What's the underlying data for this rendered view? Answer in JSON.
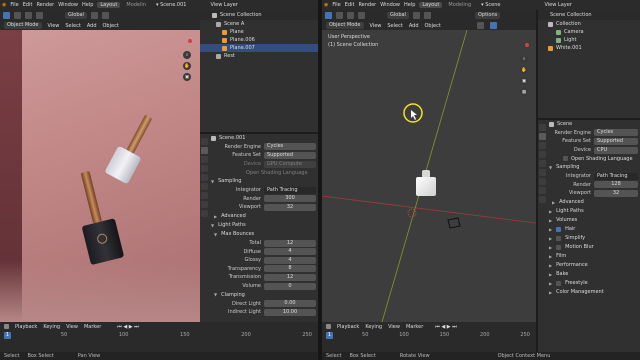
{
  "left": {
    "menu": {
      "file": "File",
      "edit": "Edit",
      "render": "Render",
      "window": "Window",
      "help": "Help",
      "layout": "Layout",
      "modeling": "Modelin",
      "scene": "Scene.001",
      "view_layer": "View Layer"
    },
    "vp_header": {
      "mode": "Object Mode",
      "view": "View",
      "select": "Select",
      "add": "Add",
      "object": "Object",
      "orientation": "Global",
      "options": "Options"
    },
    "outliner": {
      "title": "Scene Collection",
      "items": [
        {
          "name": "Scene A"
        },
        {
          "name": "Plane"
        },
        {
          "name": "Plane.006"
        },
        {
          "name": "Plane.007"
        },
        {
          "name": "Rest"
        }
      ]
    },
    "props": {
      "scene_name": "Scene.001",
      "render_engine_label": "Render Engine",
      "render_engine": "Cycles",
      "feature_set_label": "Feature Set",
      "feature_set": "Supported",
      "device_label": "Device",
      "device": "GPU Compute",
      "osl_label": "Open Shading Language",
      "sampling": "Sampling",
      "integrator_label": "Integrator",
      "integrator": "Path Tracing",
      "render_label": "Render",
      "render": "300",
      "viewport_label": "Viewport",
      "viewport": "32",
      "advanced": "Advanced",
      "light_paths": "Light Paths",
      "max_bounces": "Max Bounces",
      "total_label": "Total",
      "total": "12",
      "diffuse_label": "Diffuse",
      "diffuse": "4",
      "glossy_label": "Glossy",
      "glossy": "4",
      "transparency_label": "Transparency",
      "transparency": "8",
      "transmission_label": "Transmission",
      "transmission": "12",
      "volume_label": "Volume",
      "volume": "0",
      "clamping": "Clamping",
      "direct_label": "Direct Light",
      "direct": "0.00",
      "indirect_label": "Indirect Light",
      "indirect": "10.00"
    },
    "timeline": {
      "playback": "Playback",
      "keying": "Keying",
      "view": "View",
      "marker": "Marker",
      "frame": "1",
      "ticks": [
        "0",
        "50",
        "100",
        "150",
        "200",
        "250"
      ]
    },
    "status": {
      "select": "Select",
      "box": "Box Select",
      "pan": "Pan View"
    }
  },
  "right": {
    "menu": {
      "file": "File",
      "edit": "Edit",
      "render": "Render",
      "window": "Window",
      "help": "Help",
      "layout": "Layout",
      "modeling": "Modeling",
      "scene": "Scene",
      "view_layer": "View Layer"
    },
    "vp_header": {
      "mode": "Object Mode",
      "view": "View",
      "select": "Select",
      "add": "Add",
      "object": "Object",
      "orientation": "Global",
      "options": "Options"
    },
    "viewport": {
      "perspective": "User Perspective",
      "collection": "(1) Scene Collection"
    },
    "outliner": {
      "title": "Scene Collection",
      "items": [
        {
          "name": "Collection"
        },
        {
          "name": "Camera"
        },
        {
          "name": "Light"
        },
        {
          "name": "White.001"
        }
      ]
    },
    "props": {
      "scene_name": "Scene",
      "render_engine_label": "Render Engine",
      "render_engine": "Cycles",
      "feature_set_label": "Feature Set",
      "feature_set": "Supported",
      "device_label": "Device",
      "device": "CPU",
      "osl_label": "Open Shading Language",
      "sampling": "Sampling",
      "integrator_label": "Integrator",
      "integrator": "Path Tracing",
      "render_label": "Render",
      "render": "128",
      "viewport_label": "Viewport",
      "viewport": "32",
      "advanced": "Advanced",
      "sections": [
        "Light Paths",
        "Volumes",
        "Hair",
        "Simplify",
        "Motion Blur",
        "Film",
        "Performance",
        "Bake",
        "Freestyle",
        "Color Management"
      ]
    },
    "timeline": {
      "playback": "Playback",
      "keying": "Keying",
      "view": "View",
      "marker": "Marker",
      "frame": "1",
      "ticks": [
        "0",
        "50",
        "100",
        "150",
        "200",
        "250"
      ]
    },
    "status": {
      "select": "Select",
      "box": "Box Select",
      "rotate": "Rotate View",
      "context": "Object Context Menu"
    }
  },
  "colors": {
    "accent": "#4772b3",
    "header": "#303030",
    "panel": "#303030",
    "viewport": "#3d3d3d",
    "axis_red": "#a33a3a",
    "axis_green": "#7f9a2c",
    "cursor_ring": "#f5e12a"
  }
}
